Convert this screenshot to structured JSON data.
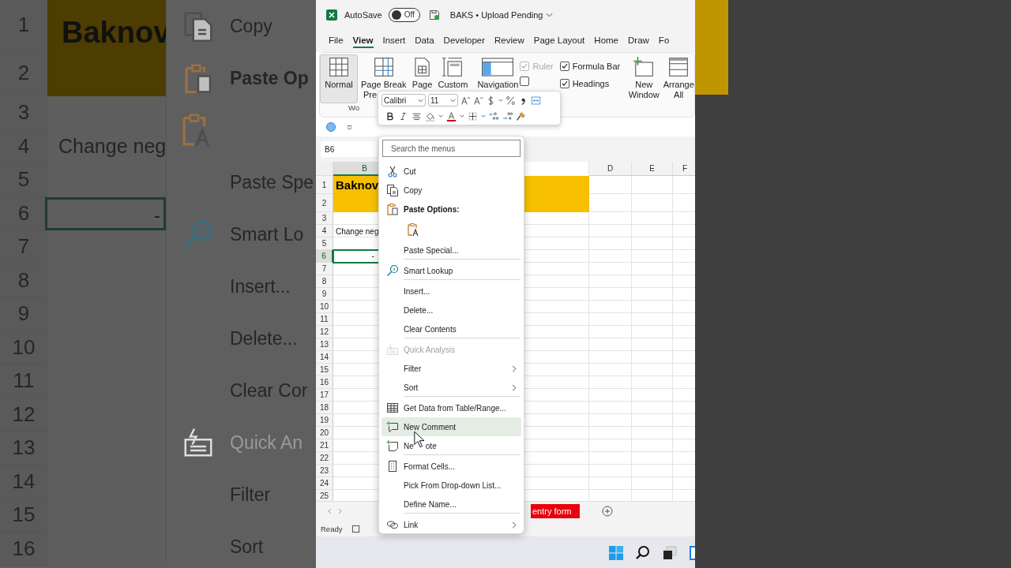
{
  "backdrop": {
    "row_numbers": [
      "1",
      "2",
      "3",
      "4",
      "5",
      "6",
      "7",
      "8",
      "9",
      "10",
      "11",
      "12",
      "13",
      "14",
      "15",
      "16"
    ],
    "title_cell": "Baknov",
    "text_cell": "Change neg",
    "selected_cell": "-",
    "menu_items": [
      {
        "label": "Copy",
        "kind": "copy",
        "disabled": false
      },
      {
        "label": "Paste Op",
        "kind": "paste_header",
        "disabled": false
      },
      {
        "kind": "paste_values",
        "disabled": false
      },
      {
        "label": "Paste Spe",
        "kind": "plain",
        "disabled": false
      },
      {
        "label": "Smart Lo",
        "kind": "lookup",
        "disabled": false
      },
      {
        "label": "Insert...",
        "kind": "plain",
        "disabled": false
      },
      {
        "label": "Delete...",
        "kind": "plain",
        "disabled": false
      },
      {
        "label": "Clear Cor",
        "kind": "plain",
        "disabled": false
      },
      {
        "label": "Quick An",
        "kind": "quick_analysis",
        "disabled": true
      },
      {
        "label": "Filter",
        "kind": "plain",
        "disabled": false
      },
      {
        "label": "Sort",
        "kind": "plain",
        "disabled": false
      }
    ]
  },
  "window": {
    "autosave_label": "AutoSave",
    "autosave_state": "Off",
    "autosave_on": false,
    "title": "BAKS • Upload Pending"
  },
  "tabs": [
    {
      "label": "File",
      "selected": false
    },
    {
      "label": "View",
      "selected": true
    },
    {
      "label": "Insert",
      "selected": false
    },
    {
      "label": "Data",
      "selected": false
    },
    {
      "label": "Developer",
      "selected": false
    },
    {
      "label": "Review",
      "selected": false
    },
    {
      "label": "Page Layout",
      "selected": false
    },
    {
      "label": "Home",
      "selected": false
    },
    {
      "label": "Draw",
      "selected": false
    },
    {
      "label": "Fo",
      "selected": false
    }
  ],
  "ribbon": {
    "view_buttons": [
      {
        "label": "Normal",
        "kind": "normal",
        "selected": true
      },
      {
        "label": "Page Break",
        "label_2": "Pre",
        "kind": "page_break",
        "selected": false
      },
      {
        "label": "Page",
        "kind": "page",
        "selected": false
      },
      {
        "label": "Custom",
        "kind": "custom",
        "selected": false
      }
    ],
    "group_label": "Wo",
    "navigation": "Navigation",
    "checkboxes": [
      {
        "label": "Ruler",
        "checked": true,
        "disabled": true
      },
      {
        "checked": false,
        "disabled": false
      },
      {
        "label": "Formula Bar",
        "checked": true,
        "disabled": false
      },
      {
        "label": "Headings",
        "checked": true,
        "disabled": false
      }
    ],
    "window_buttons": [
      {
        "label": "New Window",
        "kind": "new_window"
      },
      {
        "label": "Arrange All",
        "kind": "arrange_all"
      }
    ]
  },
  "mini_toolbar": {
    "font": "Calibri",
    "size": "11"
  },
  "name_box": "B6",
  "columns": [
    {
      "label": "B",
      "selected": true
    },
    {
      "label": "D",
      "selected": false
    },
    {
      "label": "E",
      "selected": false
    },
    {
      "label": "F",
      "selected": false
    }
  ],
  "rows": [
    {
      "label": "1",
      "selected": false
    },
    {
      "label": "2",
      "selected": false
    },
    {
      "label": "3",
      "selected": false
    },
    {
      "label": "4",
      "selected": false
    },
    {
      "label": "5",
      "selected": false
    },
    {
      "label": "6",
      "selected": true
    },
    {
      "label": "7",
      "selected": false
    },
    {
      "label": "8",
      "selected": false
    },
    {
      "label": "9",
      "selected": false
    },
    {
      "label": "10",
      "selected": false
    },
    {
      "label": "11",
      "selected": false
    },
    {
      "label": "12",
      "selected": false
    },
    {
      "label": "13",
      "selected": false
    },
    {
      "label": "14",
      "selected": false
    },
    {
      "label": "15",
      "selected": false
    },
    {
      "label": "16",
      "selected": false
    },
    {
      "label": "17",
      "selected": false
    },
    {
      "label": "18",
      "selected": false
    },
    {
      "label": "19",
      "selected": false
    },
    {
      "label": "20",
      "selected": false
    },
    {
      "label": "21",
      "selected": false
    },
    {
      "label": "22",
      "selected": false
    },
    {
      "label": "23",
      "selected": false
    },
    {
      "label": "24",
      "selected": false
    },
    {
      "label": "25",
      "selected": false
    }
  ],
  "cells": {
    "title": "Baknov",
    "text": "Change neg",
    "selected_value": "-"
  },
  "context_menu": {
    "search_placeholder": "Search the menus",
    "items": [
      {
        "label": "Cut",
        "kind": "cut",
        "disabled": false,
        "selected": false,
        "submenu": false,
        "divider_after": false
      },
      {
        "label": "Copy",
        "kind": "copy",
        "disabled": false,
        "selected": false,
        "submenu": false,
        "divider_after": false
      },
      {
        "label": "Paste Options:",
        "kind": "paste_header"
      },
      {
        "kind": "paste_values"
      },
      {
        "label": "Paste Special...",
        "kind": "plain",
        "disabled": false,
        "selected": false,
        "submenu": false,
        "divider_after": true
      },
      {
        "label": "Smart Lookup",
        "kind": "lookup",
        "disabled": false,
        "selected": false,
        "submenu": false,
        "divider_after": true
      },
      {
        "label": "Insert...",
        "kind": "plain",
        "disabled": false,
        "selected": false,
        "submenu": false,
        "divider_after": false
      },
      {
        "label": "Delete...",
        "kind": "plain",
        "disabled": false,
        "selected": false,
        "submenu": false,
        "divider_after": false
      },
      {
        "label": "Clear Contents",
        "kind": "plain",
        "disabled": false,
        "selected": false,
        "submenu": false,
        "divider_after": true
      },
      {
        "label": "Quick Analysis",
        "kind": "quick_analysis",
        "disabled": true,
        "selected": false,
        "submenu": false,
        "divider_after": false
      },
      {
        "label": "Filter",
        "kind": "plain",
        "disabled": false,
        "selected": false,
        "submenu": true,
        "divider_after": false
      },
      {
        "label": "Sort",
        "kind": "plain",
        "disabled": false,
        "selected": false,
        "submenu": true,
        "divider_after": true
      },
      {
        "label": "Get Data from Table/Range...",
        "kind": "get_data",
        "disabled": false,
        "selected": false,
        "submenu": false,
        "divider_after": false
      },
      {
        "label": "New Comment",
        "kind": "new_comment",
        "disabled": false,
        "selected": true,
        "submenu": false,
        "divider_after": false
      },
      {
        "label": "Ne",
        "label_tail": "ote",
        "kind": "new_note",
        "disabled": false,
        "selected": false,
        "submenu": false,
        "divider_after": true
      },
      {
        "label": "Format Cells...",
        "kind": "format_cells",
        "disabled": false,
        "selected": false,
        "submenu": false,
        "divider_after": false
      },
      {
        "label": "Pick From Drop-down List...",
        "kind": "plain",
        "disabled": false,
        "selected": false,
        "submenu": false,
        "divider_after": false
      },
      {
        "label": "Define Name...",
        "kind": "plain",
        "disabled": false,
        "selected": false,
        "submenu": false,
        "divider_after": true
      },
      {
        "label": "Link",
        "kind": "link",
        "disabled": false,
        "selected": false,
        "submenu": true,
        "divider_after": false
      }
    ]
  },
  "sheet_tabs": [
    {
      "label": "entry form",
      "color": "#e8000b"
    }
  ],
  "status_bar": {
    "text": "Ready"
  }
}
